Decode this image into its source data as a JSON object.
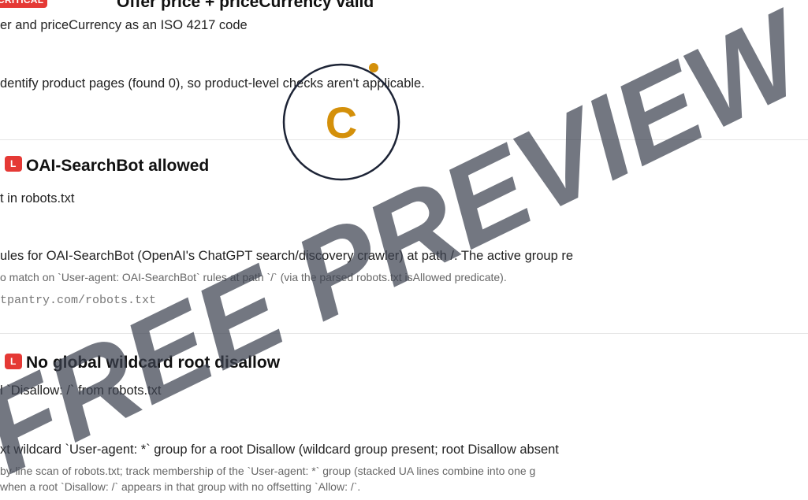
{
  "section1": {
    "badge": "CRITICAL",
    "title": "Offer price + priceCurrency valid",
    "subtitle": "er and priceCurrency as an ISO 4217 code",
    "body": "dentify product pages (found 0), so product-level checks aren't applicable."
  },
  "logo": {
    "letter": "C",
    "accent_color": "#d4900a",
    "ring_color": "#1d2436"
  },
  "section2": {
    "badge": "L",
    "title": "OAI-SearchBot allowed",
    "subtitle": "t in robots.txt",
    "body": "ules for OAI-SearchBot (OpenAI's ChatGPT search/discovery crawler) at path /. The active group re",
    "detail": "o match on `User-agent: OAI-SearchBot` rules at path `/` (via the parsed robots.txt isAllowed predicate).",
    "source": "tpantry.com/robots.txt"
  },
  "section3": {
    "badge": "L",
    "title": "No global wildcard root disallow",
    "subtitle": "l `Disallow: /` from robots.txt",
    "body": "xt wildcard `User-agent: *` group for a root Disallow (wildcard group present; root Disallow absent",
    "detail_1": "by-line scan of robots.txt; track membership of the `User-agent: *` group (stacked UA lines combine into one g",
    "detail_2": "when a root `Disallow: /` appears in that group with no offsetting `Allow: /`."
  },
  "watermark": {
    "text": "FREE PREVIEW",
    "color": "#3d4350"
  }
}
